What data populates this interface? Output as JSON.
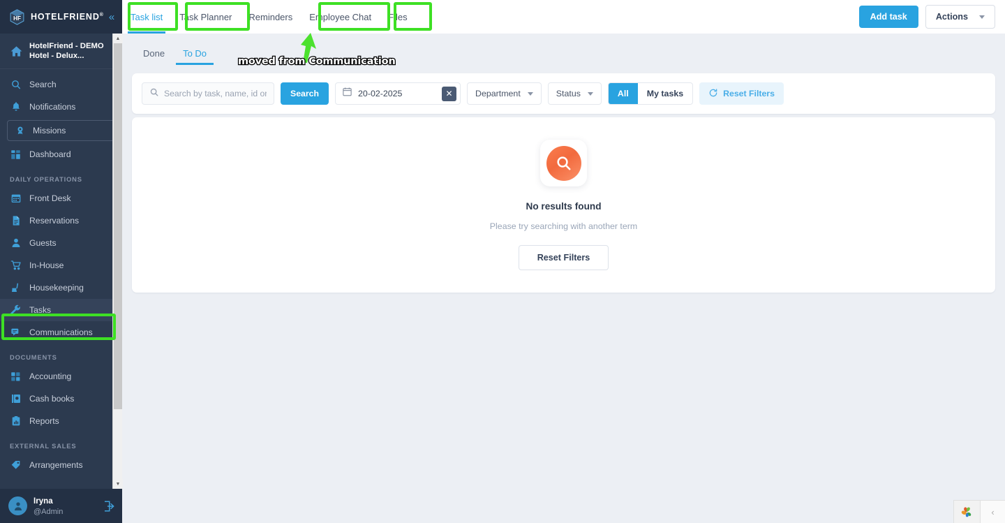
{
  "brand": {
    "name": "HOTELFRIEND",
    "tm": "®",
    "logo_icon": "hotelfriend-cube-logo",
    "collapse_icon": "collapse-sidebar-icon"
  },
  "sidebar": {
    "hotel": {
      "label": "HotelFriend - DEMO Hotel - Delux...",
      "line1": "HotelFriend - DEMO",
      "line2": "Hotel - Delux...",
      "icon": "home-icon",
      "chevron": "›"
    },
    "items": [
      {
        "label": "Search",
        "icon": "search-icon",
        "type": "link"
      },
      {
        "label": "Notifications",
        "icon": "bell-icon",
        "type": "link"
      },
      {
        "label": "Missions",
        "icon": "medal-icon",
        "type": "boxed"
      },
      {
        "label": "Dashboard",
        "icon": "dashboard-grid-icon",
        "type": "link"
      },
      {
        "label": "DAILY OPERATIONS",
        "type": "section"
      },
      {
        "label": "Front Desk",
        "icon": "calendar-icon",
        "type": "link"
      },
      {
        "label": "Reservations",
        "icon": "document-icon",
        "type": "link"
      },
      {
        "label": "Guests",
        "icon": "person-icon",
        "type": "link"
      },
      {
        "label": "In-House",
        "icon": "cart-icon",
        "type": "link",
        "arrow": "›"
      },
      {
        "label": "Housekeeping",
        "icon": "broom-icon",
        "type": "link"
      },
      {
        "label": "Tasks",
        "icon": "wrench-icon",
        "type": "link",
        "active": true,
        "highlighted": true
      },
      {
        "label": "Communications",
        "icon": "chat-icon",
        "type": "link",
        "arrow": "›"
      },
      {
        "label": "DOCUMENTS",
        "type": "section"
      },
      {
        "label": "Accounting",
        "icon": "accounting-grid-icon",
        "type": "link",
        "arrow": "›"
      },
      {
        "label": "Cash books",
        "icon": "book-icon",
        "type": "link"
      },
      {
        "label": "Reports",
        "icon": "clipboard-chart-icon",
        "type": "link"
      },
      {
        "label": "EXTERNAL SALES",
        "type": "section"
      },
      {
        "label": "Arrangements",
        "icon": "tag-icon",
        "type": "link"
      }
    ],
    "scrollbar": {
      "up_arrow_icon": "scroll-up-arrow-icon",
      "down_arrow_icon": "scroll-down-arrow-icon"
    },
    "user": {
      "name": "Iryna",
      "handle": "@Admin",
      "avatar_icon": "user-avatar-icon",
      "logout_icon": "logout-icon"
    }
  },
  "topbar": {
    "tabs": [
      {
        "label": "Task list",
        "active": true,
        "highlighted": true
      },
      {
        "label": "Task Planner",
        "active": false,
        "highlighted": true
      },
      {
        "label": "Reminders",
        "active": false,
        "highlighted": false
      },
      {
        "label": "Employee Chat",
        "active": false,
        "highlighted": true
      },
      {
        "label": "Files",
        "active": false,
        "highlighted": true
      }
    ],
    "add_task_label": "Add task",
    "actions_label": "Actions",
    "actions_caret_icon": "caret-down-icon"
  },
  "subtabs": [
    {
      "label": "Done",
      "active": false
    },
    {
      "label": "To Do",
      "active": true
    }
  ],
  "filters": {
    "search": {
      "value": "",
      "placeholder": "Search by task, name, id or ...",
      "icon": "search-icon"
    },
    "search_button_label": "Search",
    "date": {
      "value": "20-02-2025",
      "calendar_icon": "calendar-icon",
      "clear_icon": "clear-x-icon"
    },
    "department": {
      "label": "Department",
      "caret_icon": "chevron-down-icon"
    },
    "status": {
      "label": "Status",
      "caret_icon": "chevron-down-icon"
    },
    "scope": [
      {
        "label": "All",
        "selected": true
      },
      {
        "label": "My tasks",
        "selected": false
      }
    ],
    "reset_filters_label": "Reset Filters",
    "reset_filters_icon": "refresh-icon"
  },
  "empty_state": {
    "icon": "search-magnifier-icon",
    "title": "No results found",
    "subtitle": "Please try searching with another term",
    "button_label": "Reset Filters"
  },
  "annotations": {
    "note_text": "moved from Communication",
    "arrow_icon": "green-arrow-icon",
    "highlight_color": "#3ee024"
  },
  "bottom_widget": {
    "logo_icon": "pinwheel-leaf-logo-icon",
    "collapse_icon": "chevron-left-icon"
  },
  "colors": {
    "accent": "#29a3e0",
    "sidebar_bg": "#2c3a4f",
    "sidebar_dark": "#233044",
    "page_bg": "#eceff4",
    "highlight_green": "#3ee024",
    "empty_orange": "#f26a3e"
  }
}
